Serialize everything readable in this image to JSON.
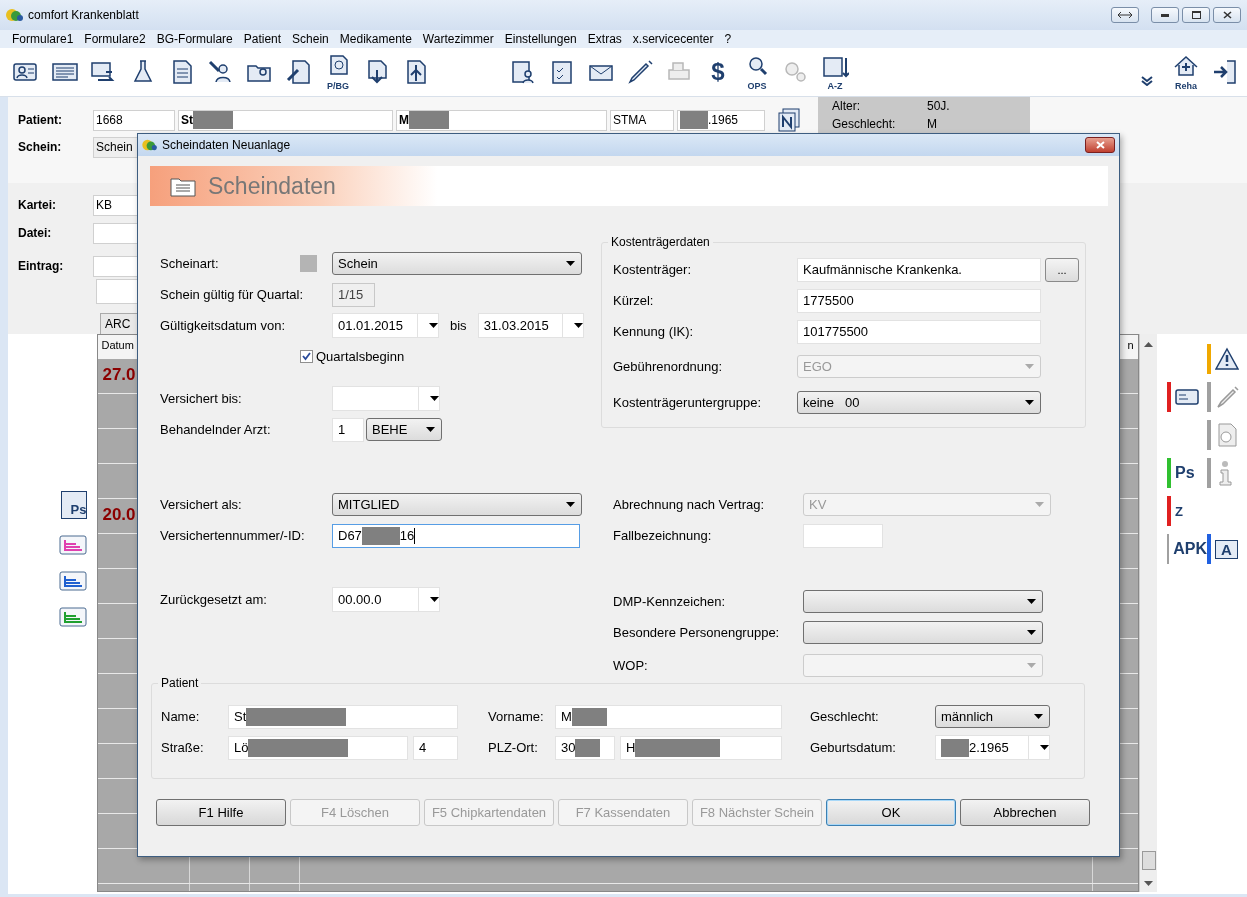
{
  "window": {
    "title": "comfort Krankenblatt"
  },
  "menu": [
    "Formulare1",
    "Formulare2",
    "BG-Formulare",
    "Patient",
    "Schein",
    "Medikamente",
    "Wartezimmer",
    "Einstellungen",
    "Extras",
    "x.servicecenter",
    "?"
  ],
  "toolbar": {
    "left": [
      {
        "kind": "person-card",
        "disabled": false
      },
      {
        "kind": "newspaper",
        "disabled": false
      },
      {
        "kind": "card-swap",
        "disabled": false
      },
      {
        "kind": "flask",
        "disabled": false
      },
      {
        "kind": "document",
        "disabled": false
      },
      {
        "kind": "pen-person",
        "disabled": false
      },
      {
        "kind": "folder-person",
        "disabled": false
      },
      {
        "kind": "pen-doc",
        "disabled": false
      },
      {
        "kind": "euro-doc",
        "label": "P/BG",
        "disabled": false
      },
      {
        "kind": "doc-arrow",
        "disabled": false
      },
      {
        "kind": "tree-doc",
        "disabled": false
      }
    ],
    "middle": [
      {
        "kind": "clipboard-person",
        "disabled": false
      },
      {
        "kind": "clipboard-check",
        "disabled": false
      },
      {
        "kind": "envelope",
        "disabled": false
      },
      {
        "kind": "syringe",
        "disabled": false
      },
      {
        "kind": "printer",
        "disabled": true
      },
      {
        "kind": "glyph",
        "label": "$",
        "disabled": false
      },
      {
        "kind": "magnifier",
        "label": "OPS",
        "disabled": false
      },
      {
        "kind": "gears",
        "disabled": true
      },
      {
        "kind": "sort-doc",
        "label": "A-Z",
        "disabled": false
      }
    ],
    "right": [
      {
        "kind": "chevron",
        "disabled": false
      },
      {
        "kind": "house",
        "label": "Reha",
        "disabled": false
      },
      {
        "kind": "exit",
        "disabled": false
      }
    ]
  },
  "patient_header": {
    "patient_label": "Patient:",
    "number": "1668",
    "surname": "St",
    "first_name": "M",
    "short": "STMA",
    "birth": ".1965",
    "schein_label": "Schein:",
    "schein": "Schein",
    "age_label": "Alter:",
    "age": "50J.",
    "sex_label": "Geschlecht:",
    "sex": "M"
  },
  "kartei": {
    "kartei_label": "Kartei:",
    "kartei": "KB",
    "datei_label": "Datei:",
    "eintrag_label": "Eintrag:",
    "tab": "ARC"
  },
  "left_icons": [
    {
      "kind": "ps-doc",
      "label": "Ps"
    },
    {
      "kind": "list",
      "color": "#e040b0"
    },
    {
      "kind": "list",
      "color": "#2060d0"
    },
    {
      "kind": "list",
      "color": "#20a030"
    }
  ],
  "table": {
    "columns": [
      "Datum",
      "n"
    ],
    "rows": [
      {
        "date": "27.0"
      },
      {
        "date": "20.0"
      }
    ]
  },
  "sidebar": [
    {
      "right": {
        "kind": "warning",
        "color": "#f0a800"
      }
    },
    {
      "left": {
        "kind": "card",
        "color": "#e02020"
      },
      "right": {
        "kind": "syringe",
        "color": "#a0a0a0"
      }
    },
    {
      "right": {
        "kind": "clock-doc",
        "color": "#a0a0a0"
      }
    },
    {
      "left": {
        "kind": "text",
        "label": "Ps",
        "color": "#30c030"
      },
      "right": {
        "kind": "info",
        "color": "#a0a0a0"
      }
    },
    {
      "left": {
        "kind": "rotate",
        "label": "Z",
        "color": "#e02020"
      }
    },
    {
      "left": {
        "kind": "text",
        "label": "APK",
        "color": "#a0a0a0"
      },
      "right": {
        "kind": "folder",
        "label": "A",
        "color": "#2060e0"
      }
    }
  ],
  "dialog": {
    "title": "Scheindaten Neuanlage",
    "heading": "Scheindaten",
    "left_rows": [
      {
        "kind": "swatch-combo",
        "label": "Scheinart:",
        "value": "Schein",
        "disabled": false
      },
      {
        "kind": "readonly",
        "label": "Schein gültig für Quartal:",
        "value": "1/15"
      },
      {
        "kind": "daterange",
        "label": "Gültigkeitsdatum von:",
        "value": "01.01.2015",
        "joiner": "bis",
        "value_to": "31.03.2015"
      },
      {
        "kind": "checkbox",
        "label": "Quartalsbeginn",
        "checked": true
      },
      {
        "kind": "datecombo",
        "label": "Versichert bis:"
      },
      {
        "kind": "arzt",
        "label": "Behandelnder Arzt:",
        "value": "1",
        "option": "BEHE"
      },
      {
        "kind": "combo",
        "label": "Versichert als:",
        "value": "MITGLIED",
        "disabled": false
      },
      {
        "kind": "redacted-text",
        "label": "Versichertennummer/-ID:",
        "value": "D67",
        "value_end": "16",
        "focused": true
      },
      {
        "kind": "datecombo",
        "label": "Zurückgesetzt am:",
        "value": "00.00.0"
      }
    ],
    "cost_group": {
      "title": "Kostenträgerdaten",
      "rows": [
        {
          "kind": "text-button",
          "label": "Kostenträger:",
          "value": "Kaufmännische Krankenka.",
          "button": "..."
        },
        {
          "kind": "text",
          "label": "Kürzel:",
          "value": "1775500"
        },
        {
          "kind": "text",
          "label": "Kennung (IK):",
          "value": "101775500"
        },
        {
          "kind": "combo",
          "label": "Gebührenordnung:",
          "value": "EGO",
          "disabled": true
        },
        {
          "kind": "combo",
          "label": "Kostenträgeruntergruppe:",
          "value": "keine   00",
          "disabled": false
        }
      ]
    },
    "right_rows": [
      {
        "kind": "combo",
        "label": "Abrechnung nach Vertrag:",
        "value": "KV",
        "disabled": true
      },
      {
        "kind": "short-text",
        "label": "Fallbezeichnung:"
      },
      {
        "kind": "combo",
        "label": "DMP-Kennzeichen:",
        "disabled": false
      },
      {
        "kind": "combo",
        "label": "Besondere Personengruppe:",
        "disabled": false
      },
      {
        "kind": "combo",
        "label": "WOP:",
        "disabled": true
      }
    ],
    "patient": {
      "title": "Patient",
      "name_label": "Name:",
      "name": "St",
      "street_label": "Straße:",
      "street": "Lö",
      "house_number": "4",
      "first_name_label": "Vorname:",
      "first_name": "M",
      "city_label": "PLZ-Ort:",
      "zip": "30",
      "city": "H",
      "sex_label": "Geschlecht:",
      "sex": "männlich",
      "birth_label": "Geburtsdatum:",
      "birth": "2.1965"
    },
    "buttons": [
      {
        "label": "F1 Hilfe",
        "disabled": false,
        "default": false
      },
      {
        "label": "F4 Löschen",
        "disabled": true,
        "default": false
      },
      {
        "label": "F5 Chipkartendaten",
        "disabled": true,
        "default": false
      },
      {
        "label": "F7 Kassendaten",
        "disabled": true,
        "default": false
      },
      {
        "label": "F8 Nächster Schein",
        "disabled": true,
        "default": false
      },
      {
        "label": "OK",
        "disabled": false,
        "default": true
      },
      {
        "label": "Abbrechen",
        "disabled": false,
        "default": false
      }
    ]
  }
}
